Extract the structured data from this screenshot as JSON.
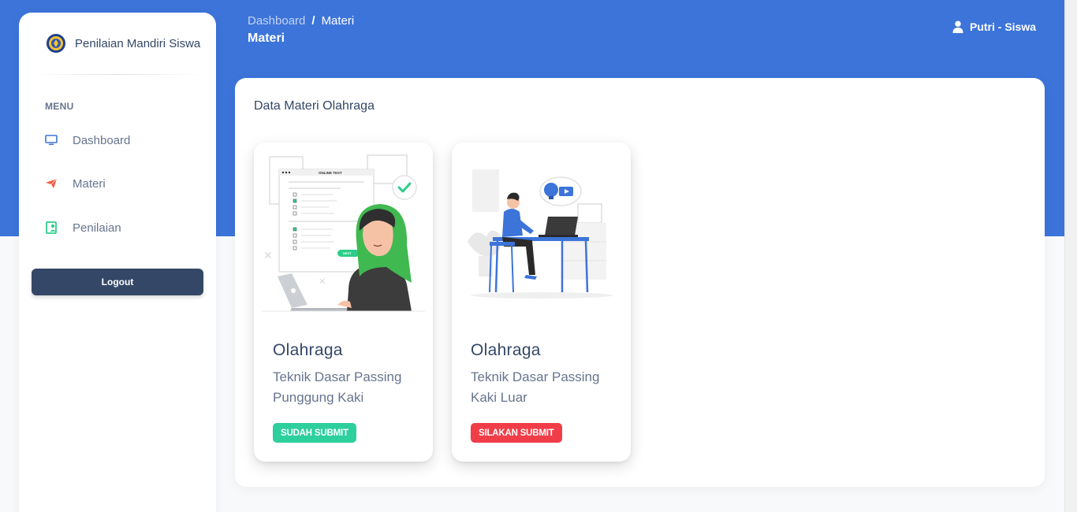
{
  "sidebar": {
    "brand_name": "Penilaian Mandiri Siswa",
    "menu_heading": "MENU",
    "items": [
      {
        "label": "Dashboard",
        "icon": "monitor-icon"
      },
      {
        "label": "Materi",
        "icon": "paper-plane-icon"
      },
      {
        "label": "Penilaian",
        "icon": "user-card-icon"
      }
    ],
    "logout_label": "Logout"
  },
  "header": {
    "breadcrumb": {
      "root": "Dashboard",
      "separator": "/",
      "current": "Materi"
    },
    "page_title": "Materi",
    "user_label": "Putri - Siswa",
    "user_icon": "user-icon"
  },
  "main": {
    "section_title": "Data Materi Olahraga",
    "cards": [
      {
        "title": "Olahraga",
        "description": "Teknik Dasar Passing Punggung Kaki",
        "status": "SUDAH SUBMIT",
        "status_color": "#2dcf9d",
        "illustration_label": "ONLINE TEST",
        "illustration_button": "NEXT"
      },
      {
        "title": "Olahraga",
        "description": "Teknik Dasar Passing Kaki Luar",
        "status": "SILAKAN SUBMIT",
        "status_color": "#f13d48"
      }
    ]
  },
  "colors": {
    "header_bg": "#3c74d9",
    "logout_bg": "#344767",
    "accent_orange": "#f5593d",
    "accent_green": "#2dce89"
  }
}
